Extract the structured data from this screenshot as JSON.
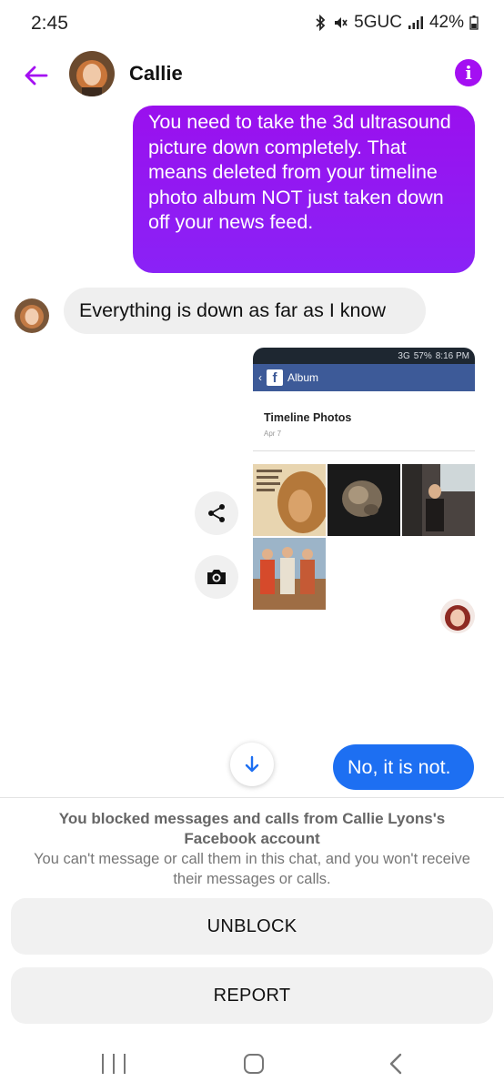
{
  "status_bar": {
    "time": "2:45",
    "network": "5GUC",
    "battery": "42%"
  },
  "header": {
    "contact_name": "Callie",
    "info_glyph": "i",
    "accent_color": "#a40ff2"
  },
  "messages": {
    "outgoing_1": "You need to take the 3d ultrasound picture down completely. That means deleted from your timeline photo album NOT just taken down off your news feed.",
    "incoming_1": "Everything is down as far as I know",
    "outgoing_2": "No, it is not."
  },
  "attachment": {
    "status_time": "8:16 PM",
    "status_battery": "57%",
    "status_signal": "3G",
    "navbar_title": "Album",
    "album_title": "Timeline Photos",
    "album_date": "Apr 7"
  },
  "blocked": {
    "title": "You blocked messages and calls from Callie Lyons's Facebook account",
    "description": "You can't message or call them in this chat, and you won't receive their messages or calls.",
    "unblock_label": "UNBLOCK",
    "report_label": "REPORT"
  },
  "icons": {
    "back": "arrow-left-icon",
    "info": "info-icon",
    "share": "share-icon",
    "camera": "camera-icon",
    "scroll_down": "arrow-down-icon"
  },
  "colors": {
    "outgoing_purple": "#9a10ee",
    "outgoing_blue": "#1d6ff2",
    "incoming_gray": "#efefef"
  }
}
